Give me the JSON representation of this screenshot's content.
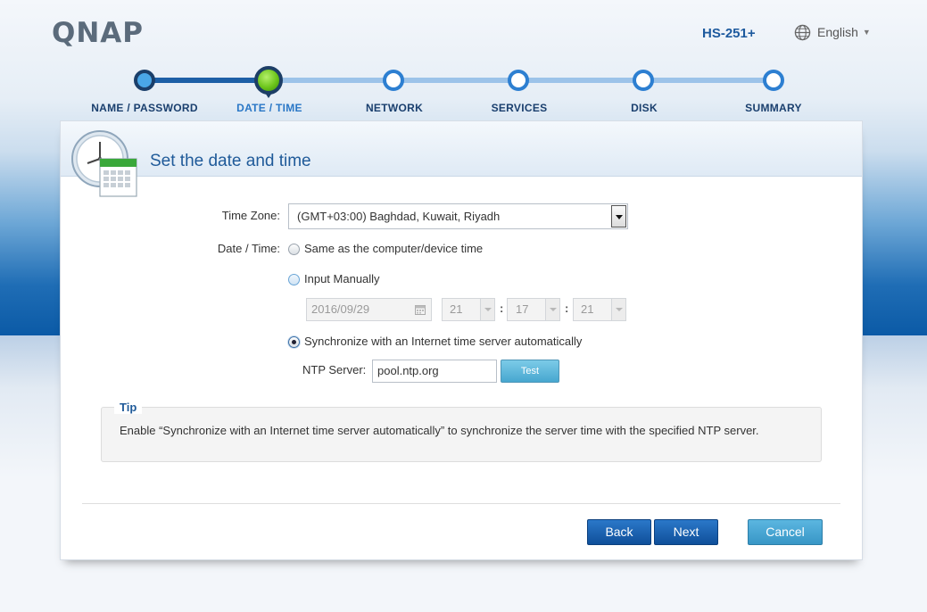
{
  "header": {
    "logo_text": "QNAP",
    "model": "HS-251+",
    "language": "English"
  },
  "steps": [
    {
      "label": "NAME / PASSWORD",
      "state": "done"
    },
    {
      "label": "DATE / TIME",
      "state": "current"
    },
    {
      "label": "NETWORK",
      "state": "todo"
    },
    {
      "label": "SERVICES",
      "state": "todo"
    },
    {
      "label": "DISK",
      "state": "todo"
    },
    {
      "label": "SUMMARY",
      "state": "todo"
    }
  ],
  "panel": {
    "title": "Set the date and time"
  },
  "form": {
    "timezone_label": "Time Zone:",
    "timezone_value": "(GMT+03:00) Baghdad, Kuwait, Riyadh",
    "datetime_label": "Date / Time:",
    "option_same": "Same as the computer/device time",
    "option_manual": "Input Manually",
    "manual_date": "2016/09/29",
    "manual_hour": "21",
    "manual_minute": "17",
    "manual_second": "21",
    "time_separator": ":",
    "option_sync": "Synchronize with an Internet time server automatically",
    "ntp_label": "NTP Server:",
    "ntp_value": "pool.ntp.org",
    "test_label": "Test",
    "selected_option": "sync"
  },
  "tip": {
    "title": "Tip",
    "text": "Enable “Synchronize with an Internet time server automatically” to synchronize the server time with the specified NTP server."
  },
  "buttons": {
    "back": "Back",
    "next": "Next",
    "cancel": "Cancel"
  },
  "colors": {
    "accent": "#1f5a99",
    "primary_button": "#0f4f9a",
    "cancel_button": "#3896c6",
    "current_step": "#6cc51b"
  },
  "icons": {
    "language": "globe-icon",
    "panel": "clock-calendar-icon",
    "date_picker": "calendar-icon"
  }
}
